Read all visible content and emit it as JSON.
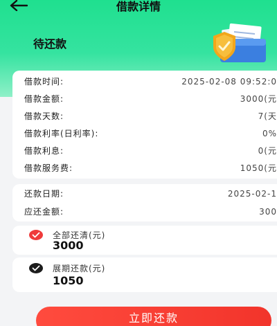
{
  "header": {
    "title": "借款详情"
  },
  "status": {
    "text": "待还款"
  },
  "loan_info": [
    {
      "label": "借款时间:",
      "value": "2025-02-08 09:52:0"
    },
    {
      "label": "借款金额:",
      "value": "3000(元"
    },
    {
      "label": "借款天数:",
      "value": "7(天"
    },
    {
      "label": "借款利率(日利率):",
      "value": "0%"
    },
    {
      "label": "借款利息:",
      "value": "0(元"
    },
    {
      "label": "借款服务费:",
      "value": "1050(元"
    }
  ],
  "repayment": [
    {
      "label": "还款日期:",
      "value": "2025-02-1"
    },
    {
      "label": "应还金额:",
      "value": "300"
    }
  ],
  "options": {
    "full": {
      "label": "全部还清(元)",
      "amount": "3000"
    },
    "extend": {
      "label": "展期还款(元)",
      "amount": "1050"
    }
  },
  "action": {
    "label": "立即还款"
  },
  "colors": {
    "brand": "#1fe08f",
    "accent": "#ef3b3b"
  }
}
